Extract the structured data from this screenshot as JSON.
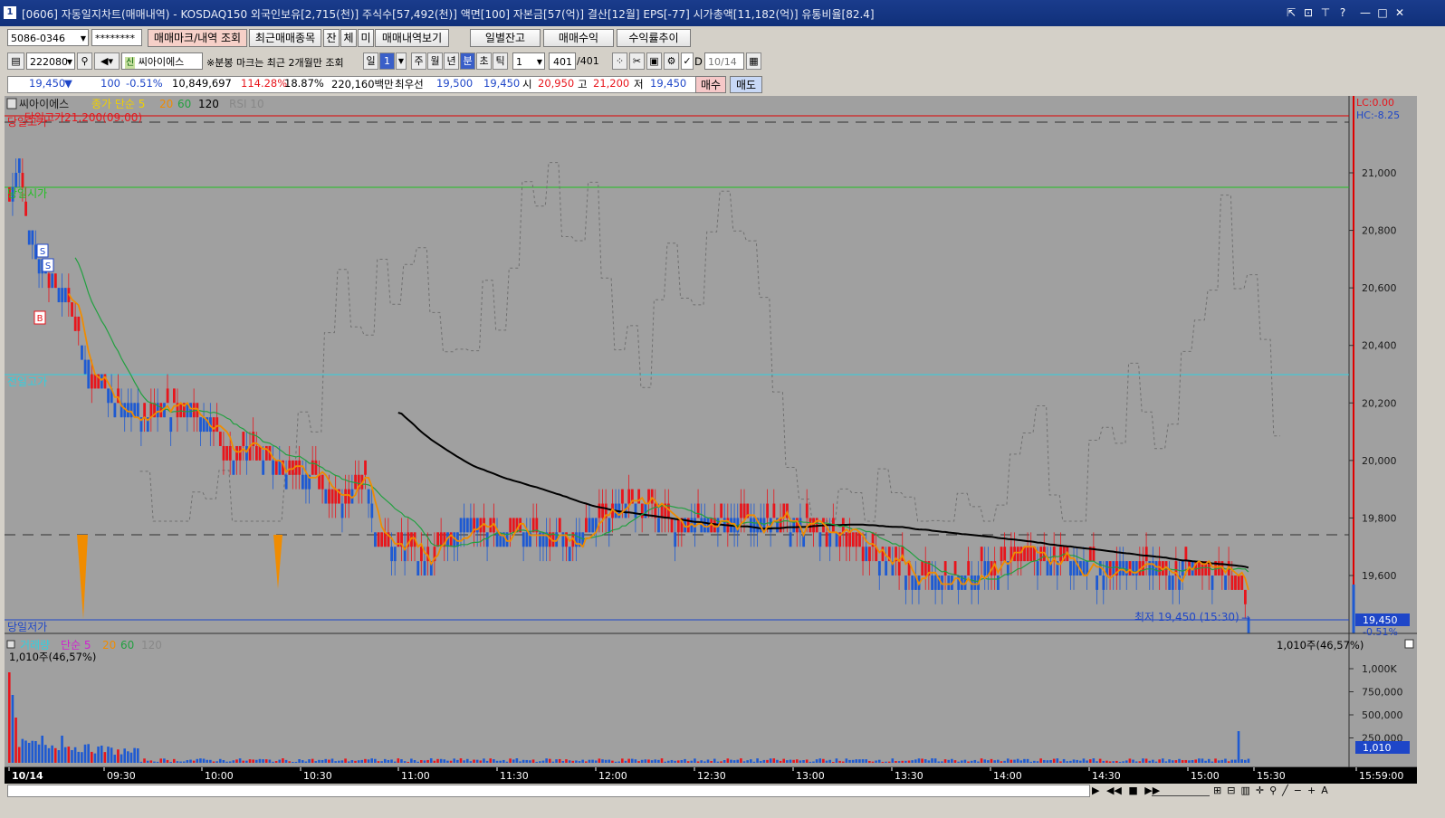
{
  "window": {
    "icon": "1",
    "title": "[0606] 자동일지차트(매매내역) - KOSDAQ150 외국인보유[2,715(천)] 주식수[57,492(천)] 액면[100] 자본금[57(억)] 결산[12월] EPS[-77] 시가총액[11,182(억)] 유통비율[82.4]",
    "controls": [
      "⇱",
      "⊡",
      "⊤",
      "?",
      "—",
      "□",
      "✕"
    ]
  },
  "toolbar1": {
    "account": "5086-0346",
    "password": "********",
    "btn_trade_mark": "매매마크/내역 조회",
    "btn_recent": "최근매매종목",
    "btn_jan": "잔",
    "btn_che": "체",
    "btn_mi": "미",
    "btn_trade_list": "매매내역보기",
    "btn_daily_balance": "일별잔고",
    "btn_profit": "매매수익",
    "btn_return_trend": "수익률추이"
  },
  "toolbar2": {
    "code": "222080",
    "stock_badge": "신",
    "stock_name": "씨아이에스",
    "note": "※분봉 마크는 최근 2개월만 조회",
    "period_il": "일",
    "period_val": "1",
    "period_ju": "주",
    "period_wol": "월",
    "period_nyeon": "년",
    "period_bun": "분",
    "period_cho": "초",
    "period_tik": "틱",
    "interval": "1",
    "count": "401",
    "count_total": "/401",
    "d_label": "D",
    "date": "10/14"
  },
  "quote": {
    "price": "19,450",
    "arrow": "▼",
    "change": "100",
    "change_pct": "-0.51%",
    "volume": "10,849,697",
    "vol_ratio": "114.28%",
    "turnover": "18.87%",
    "amount": "220,160백만",
    "best_label": "최우선",
    "best_ask": "19,500",
    "best_bid": "19,450",
    "open_label": "시",
    "open": "20,950",
    "high_label": "고",
    "high": "21,200",
    "low_label": "저",
    "low": "19,450",
    "btn_buy": "매수",
    "btn_sell": "매도"
  },
  "price_legend": {
    "stock": "씨아이에스",
    "ma_label": "종가 단순 5",
    "ma20": "20",
    "ma60": "60",
    "ma120": "120",
    "rsi": "RSI 10"
  },
  "price_annotations": {
    "day_high": "당일고가21,200(09:00)",
    "day_high_short": "당일고가",
    "day_open": "당일시가",
    "prev_high": "전일고가",
    "day_low": "당일저가",
    "low_note": "최저 19,450 (15:30)",
    "lc": "LC:0.00",
    "hc": "HC:-8.25",
    "price_tag": "19,450",
    "pct_tag": "-0.51%",
    "mark_s": "S",
    "mark_b": "B"
  },
  "volume_legend": {
    "label": "거래량",
    "ma_label": "단순 5",
    "ma20": "20",
    "ma60": "60",
    "ma120": "120",
    "last": "1,010주(46,57%)",
    "tag": "1,010"
  },
  "y_ticks": [
    "21,000",
    "20,800",
    "20,600",
    "20,400",
    "20,200",
    "20,000",
    "19,800",
    "19,600"
  ],
  "vol_ticks": [
    "1,000K",
    "750,000",
    "500,000",
    "250,000"
  ],
  "x_ticks": [
    "10/14",
    "09:30",
    "10:00",
    "10:30",
    "11:00",
    "11:30",
    "12:00",
    "12:30",
    "13:00",
    "13:30",
    "14:00",
    "14:30",
    "15:00",
    "15:30",
    "15:59:00"
  ],
  "colors": {
    "up": "#e8151c",
    "down": "#1e5ad2",
    "ma5": "#f08c00",
    "ma20": "#22a040",
    "ma120": "#000000",
    "rsi": "#707070"
  }
}
